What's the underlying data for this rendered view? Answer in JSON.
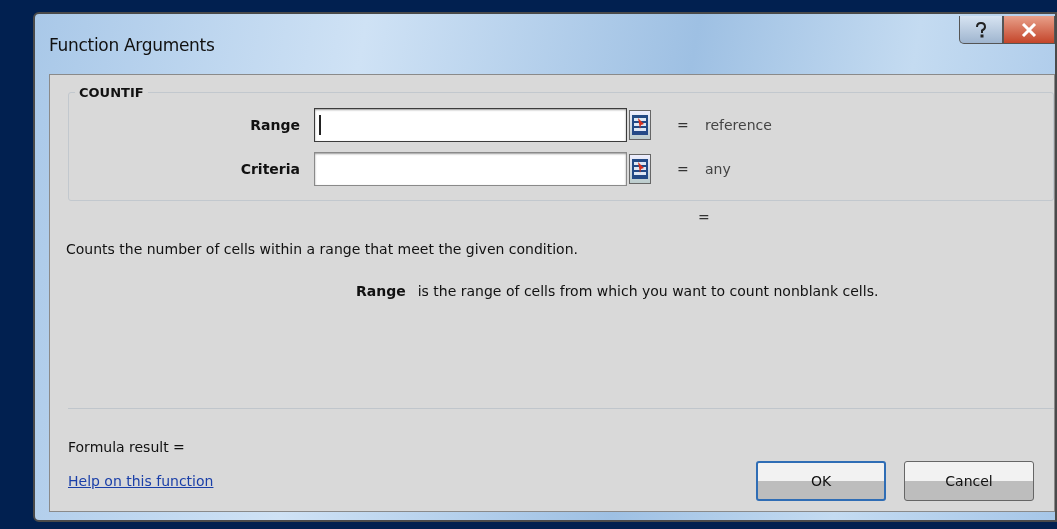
{
  "window": {
    "title": "Function Arguments"
  },
  "function_name": "COUNTIF",
  "arguments": [
    {
      "label": "Range",
      "focused": true,
      "equals": "=",
      "result": "reference"
    },
    {
      "label": "Criteria",
      "focused": false,
      "equals": "=",
      "result": "any"
    }
  ],
  "result_equals": "=",
  "description": "Counts the number of cells within a range that meet the given condition.",
  "argument_help": {
    "name": "Range",
    "text": "is the range of cells from which you want to count nonblank cells."
  },
  "formula_result": "Formula result =",
  "help_link": "Help on this function",
  "buttons": [
    {
      "label": "OK",
      "default": true
    },
    {
      "label": "Cancel",
      "default": false
    }
  ]
}
